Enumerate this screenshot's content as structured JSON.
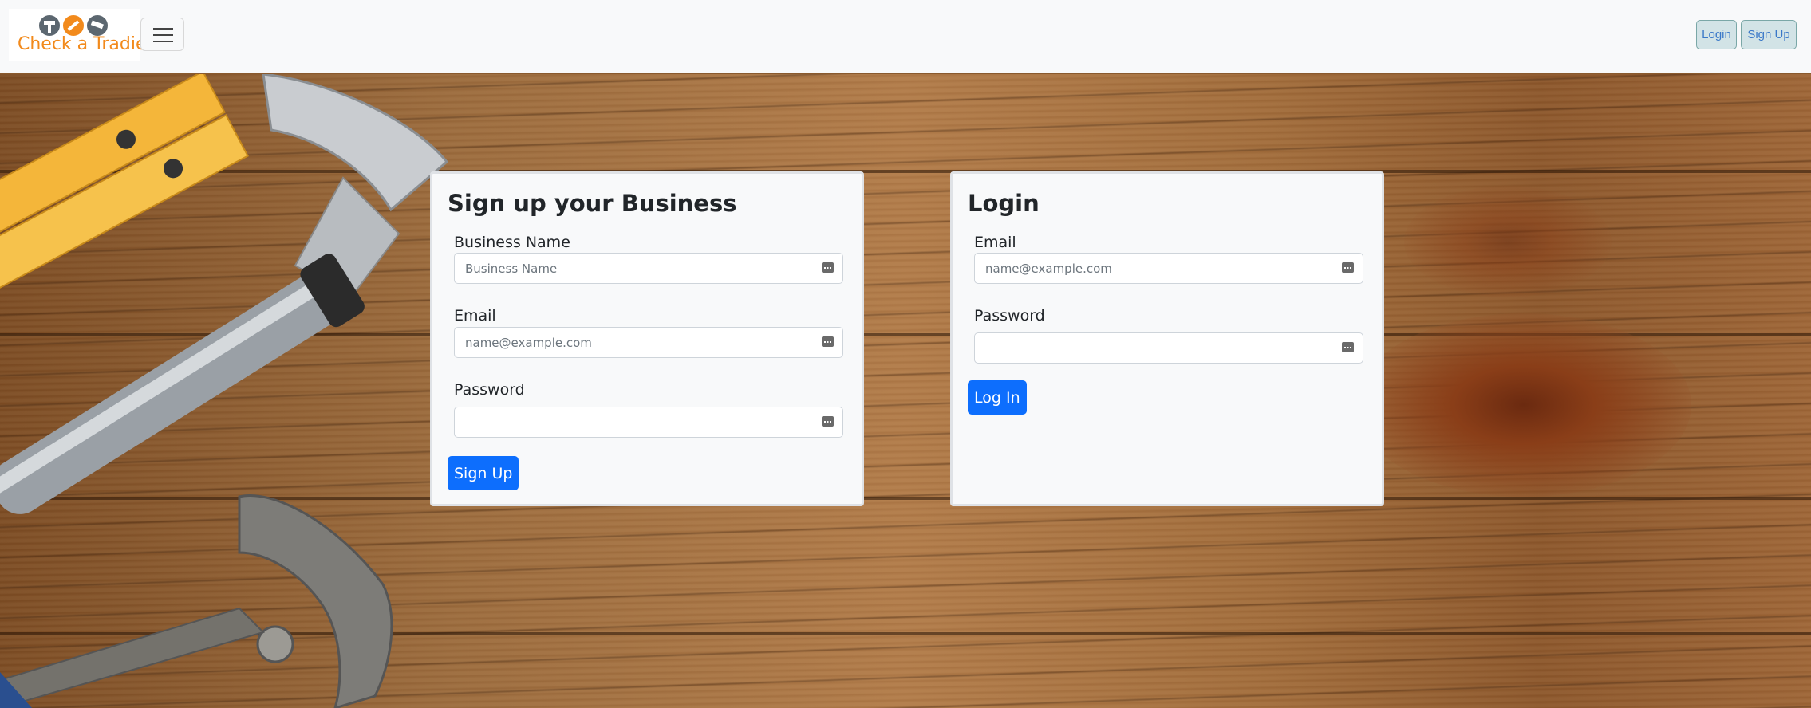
{
  "navbar": {
    "brand": "Check a Tradie",
    "login_label": "Login",
    "signup_label": "Sign Up"
  },
  "signup_form": {
    "title": "Sign up your Business",
    "business_name_label": "Business Name",
    "business_name_placeholder": "Business Name",
    "email_label": "Email",
    "email_placeholder": "name@example.com",
    "password_label": "Password",
    "password_placeholder": "",
    "submit_label": "Sign Up"
  },
  "login_form": {
    "title": "Login",
    "email_label": "Email",
    "email_placeholder": "name@example.com",
    "password_label": "Password",
    "password_placeholder": "",
    "submit_label": "Log In"
  },
  "icons": {
    "brand_logo": "tools-logo-icon",
    "menu": "hamburger-menu-icon",
    "field_autofill": "password-manager-icon"
  },
  "colors": {
    "brand_orange": "#f28a1c",
    "primary_blue": "#0d6efd",
    "card_bg": "#f8f9fa"
  }
}
